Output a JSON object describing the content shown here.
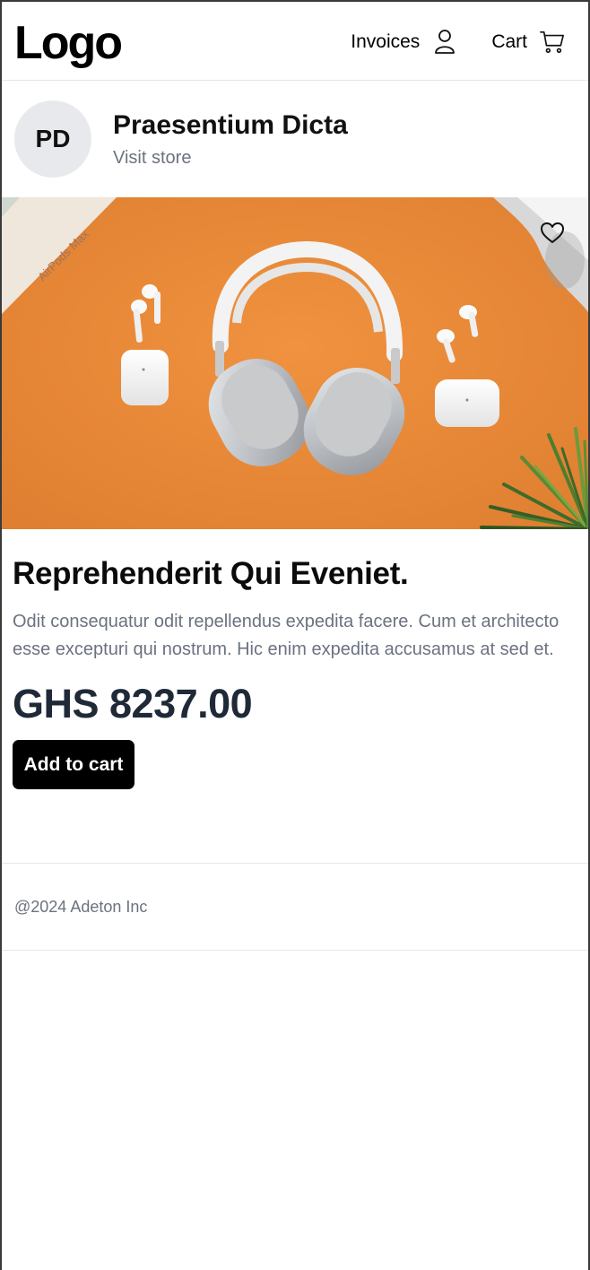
{
  "header": {
    "logo": "Logo",
    "nav": {
      "invoices_label": "Invoices",
      "cart_label": "Cart"
    }
  },
  "store": {
    "initials": "PD",
    "name": "Praesentium Dicta",
    "link_label": "Visit store"
  },
  "product": {
    "image_box_text": "AirPods Max",
    "title": "Reprehenderit Qui Eveniet.",
    "description": "Odit consequatur odit repellendus expedita facere. Cum et architecto esse excepturi qui nostrum. Hic enim expedita accusamus at sed et.",
    "price": "GHS 8237.00",
    "add_to_cart_label": "Add to cart"
  },
  "footer": {
    "copyright": "@2024 Adeton Inc"
  },
  "colors": {
    "image_background": "#e98a3a",
    "button_bg": "#000000",
    "muted_text": "#6b7280",
    "price_text": "#1f2937",
    "avatar_bg": "#e8e9ec"
  }
}
